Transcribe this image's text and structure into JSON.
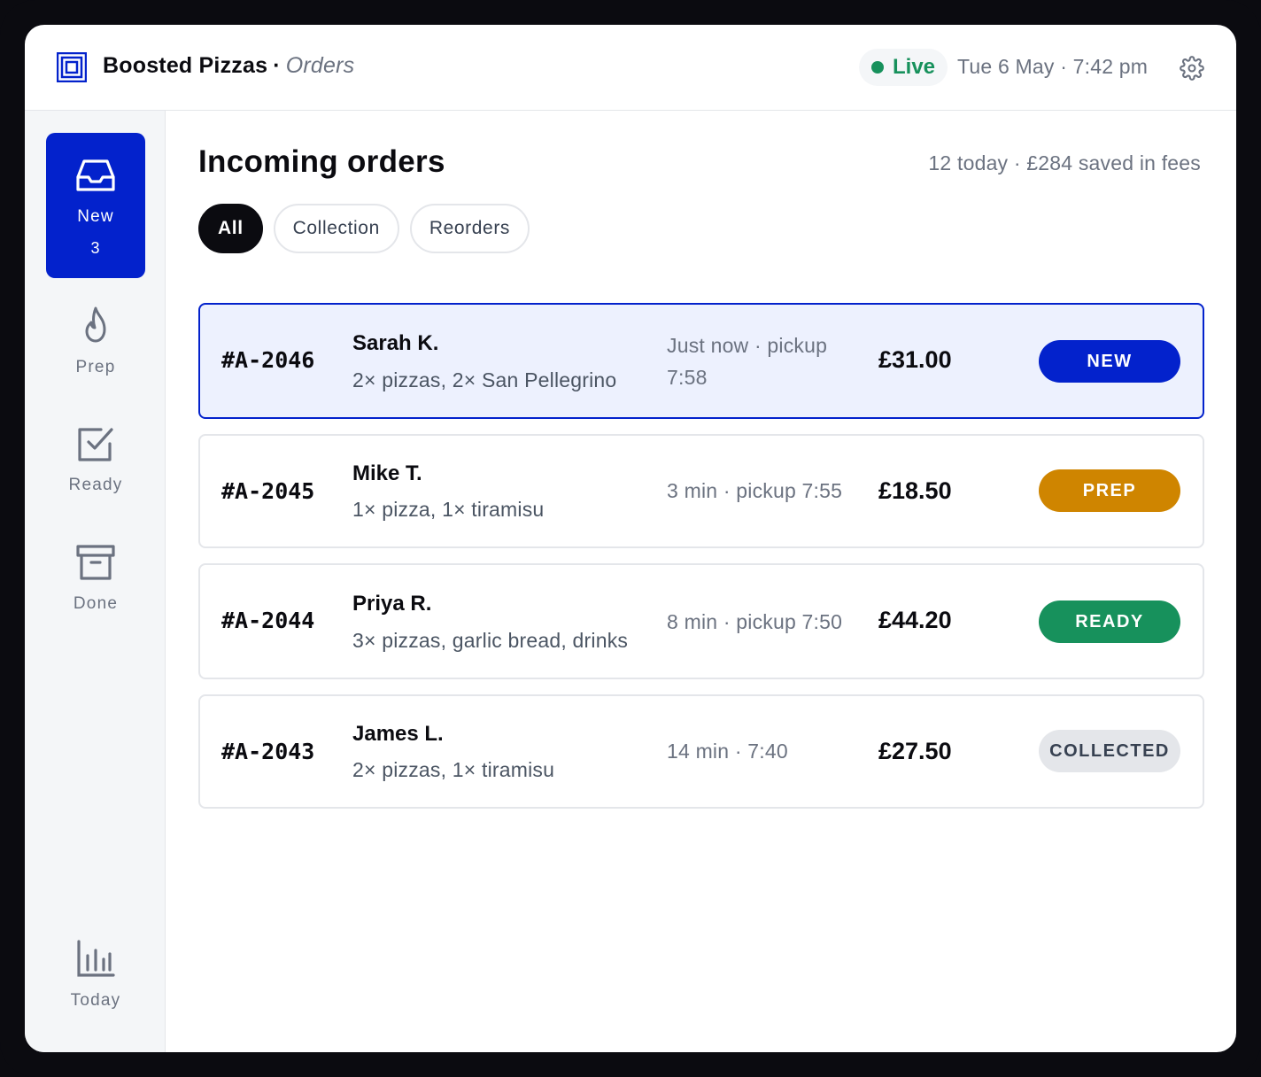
{
  "header": {
    "brand": "Boosted Pizzas",
    "separator": "·",
    "page": "Orders",
    "live_label": "Live",
    "datetime": "Tue 6 May · 7:42 pm",
    "icons": {
      "logo": "brand-logo-icon",
      "settings": "gear-icon"
    }
  },
  "sidebar": {
    "items": [
      {
        "label": "New",
        "count": "3",
        "icon": "inbox-icon",
        "active": true
      },
      {
        "label": "Prep",
        "icon": "flame-icon"
      },
      {
        "label": "Ready",
        "icon": "checkbox-icon"
      },
      {
        "label": "Done",
        "icon": "archive-icon"
      },
      {
        "label": "Today",
        "icon": "bar-chart-icon"
      }
    ]
  },
  "main": {
    "title": "Incoming orders",
    "summary": "12 today · £284 saved in fees",
    "filters": [
      {
        "label": "All",
        "active": true
      },
      {
        "label": "Collection"
      },
      {
        "label": "Reorders"
      }
    ],
    "orders": [
      {
        "id": "#A-2046",
        "customer": "Sarah K.",
        "items": "2× pizzas, 2× San Pellegrino",
        "timing_line1": "Just now · pickup",
        "timing_line2": "7:58",
        "price": "£31.00",
        "status": "NEW",
        "selected": true
      },
      {
        "id": "#A-2045",
        "customer": "Mike T.",
        "items": "1× pizza, 1× tiramisu",
        "timing_line1": "3 min · pickup 7:55",
        "price": "£18.50",
        "status": "PREP"
      },
      {
        "id": "#A-2044",
        "customer": "Priya R.",
        "items": "3× pizzas, garlic bread, drinks",
        "timing_line1": "8 min · pickup 7:50",
        "price": "£44.20",
        "status": "READY"
      },
      {
        "id": "#A-2043",
        "customer": "James L.",
        "items": "2× pizzas, 1× tiramisu",
        "timing_line1": "14 min · 7:40",
        "price": "£27.50",
        "status": "COLLECTED"
      }
    ]
  },
  "colors": {
    "accent": "#0322cc",
    "selected_bg": "#edf1fe",
    "live_green": "#17915c",
    "prep_amber": "#cf8500",
    "collected_grey": "#e4e6ea",
    "muted_text": "#6b7280"
  }
}
